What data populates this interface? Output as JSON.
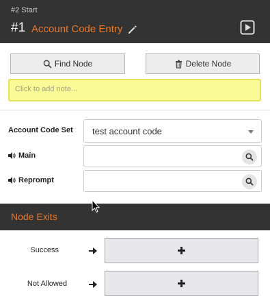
{
  "header": {
    "prev_node": "#2 Start",
    "node_number": "#1",
    "node_title": "Account Code Entry"
  },
  "actions": {
    "find_label": "Find Node",
    "delete_label": "Delete Node"
  },
  "note": {
    "placeholder": "Click to add note..."
  },
  "form": {
    "account_code_set": {
      "label": "Account Code Set",
      "value": "test account code"
    },
    "main": {
      "label": "Main",
      "value": ""
    },
    "reprompt": {
      "label": "Reprompt",
      "value": ""
    }
  },
  "exits": {
    "title": "Node Exits",
    "items": [
      {
        "label": "Success"
      },
      {
        "label": "Not Allowed"
      }
    ]
  },
  "colors": {
    "accent": "#e8782a",
    "header_bg": "#333333",
    "note_bg": "#fafa96"
  }
}
